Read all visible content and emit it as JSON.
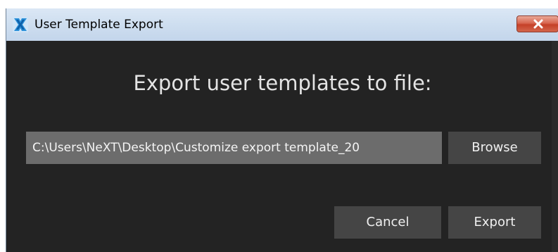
{
  "window": {
    "title": "User Template Export",
    "app_icon": "next-logo-icon",
    "close_icon": "close-icon"
  },
  "dialog": {
    "heading": "Export user templates to file:",
    "file_path": "C:\\Users\\NeXT\\Desktop\\Customize export template_20",
    "browse_label": "Browse",
    "cancel_label": "Cancel",
    "export_label": "Export"
  },
  "colors": {
    "background": "#232323",
    "field": "#6c6c6c",
    "button": "#454545",
    "text": "#e4e4e4",
    "titlebar": "#cfdff0",
    "close_button": "#c54128"
  }
}
